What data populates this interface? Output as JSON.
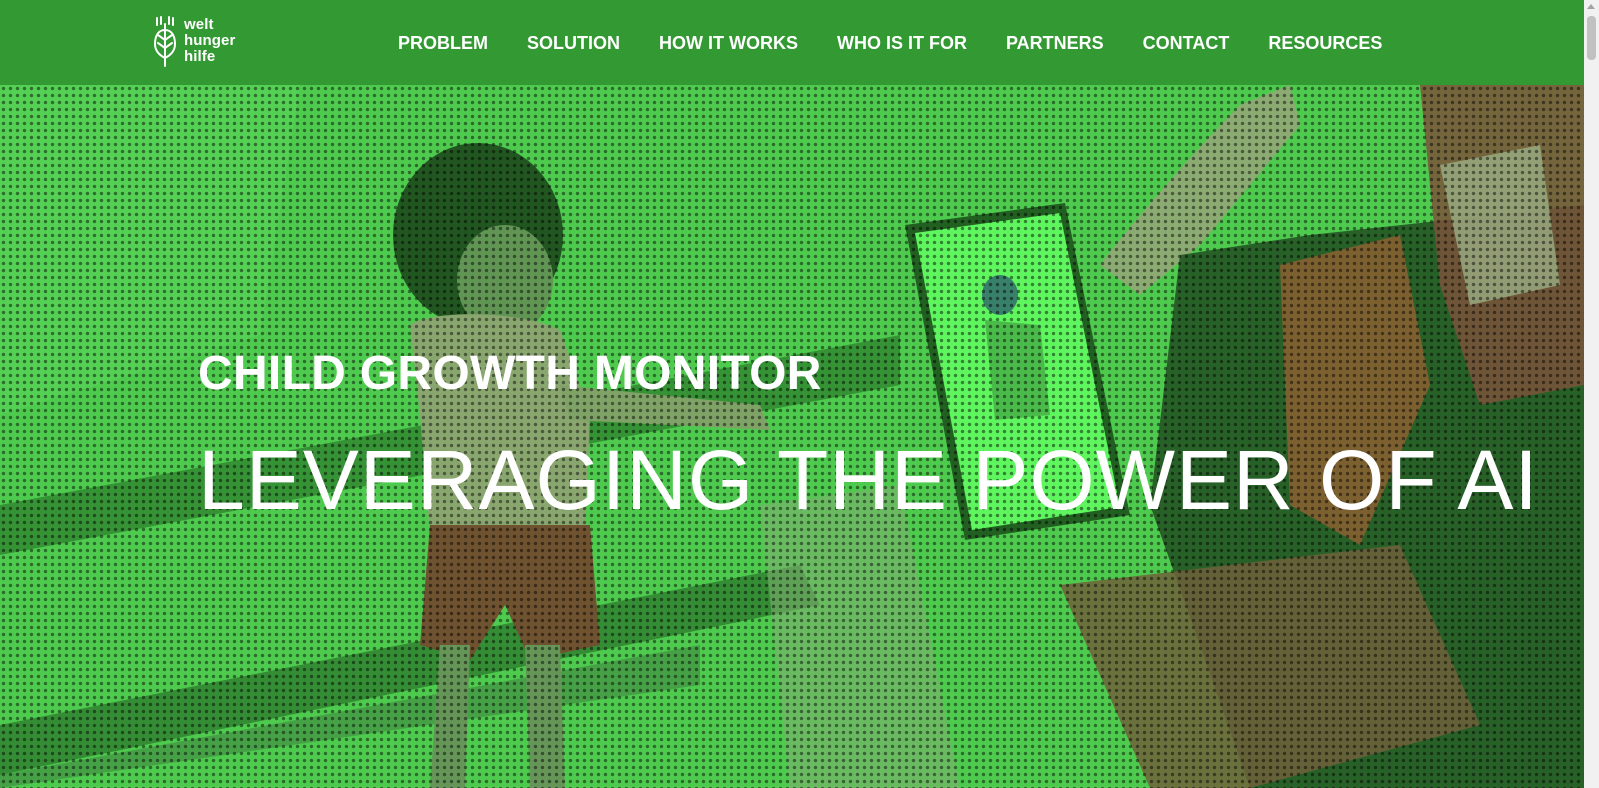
{
  "header": {
    "logo": {
      "text_lines": [
        "welt",
        "hunger",
        "hilfe"
      ],
      "icon": "wheat-logo-icon"
    },
    "nav": [
      {
        "label": "PROBLEM"
      },
      {
        "label": "SOLUTION"
      },
      {
        "label": "HOW IT WORKS"
      },
      {
        "label": "WHO IS IT FOR"
      },
      {
        "label": "PARTNERS"
      },
      {
        "label": "CONTACT"
      },
      {
        "label": "RESOURCES"
      }
    ]
  },
  "hero": {
    "eyebrow": "CHILD GROWTH MONITOR",
    "title": "LEVERAGING THE POWER OF AI"
  },
  "colors": {
    "brand_green": "#339933",
    "hero_green": "#4fc94f",
    "text_white": "#ffffff"
  }
}
